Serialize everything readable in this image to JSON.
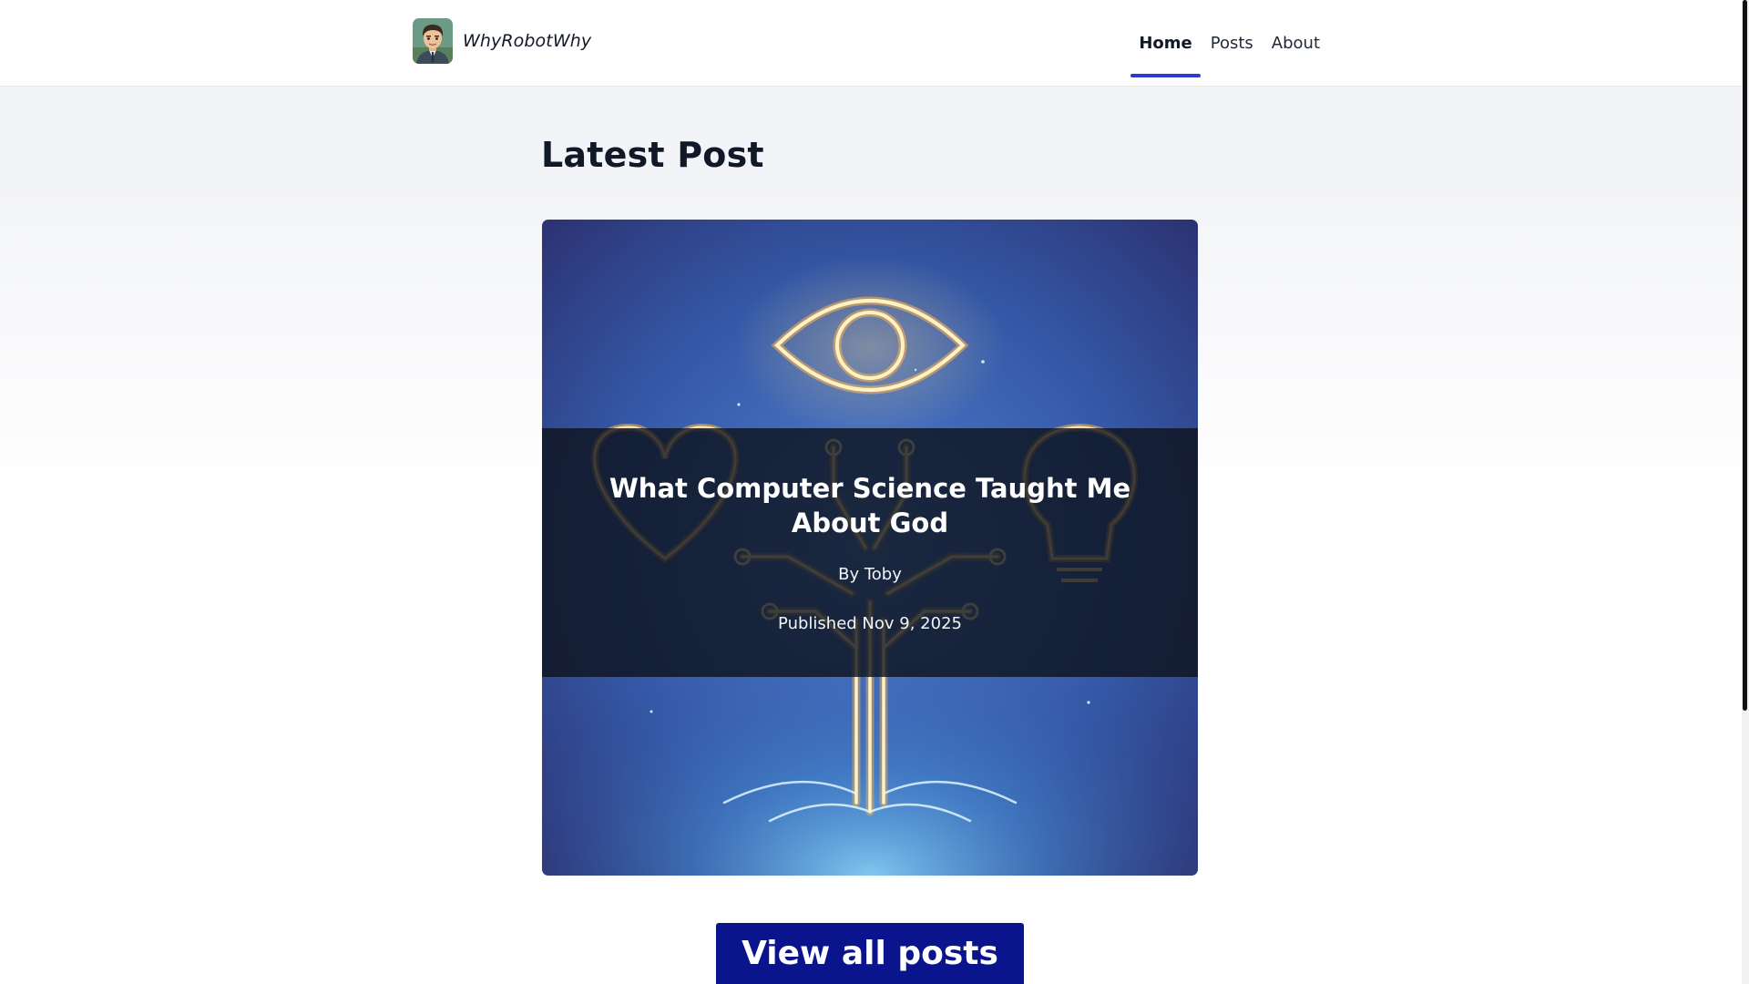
{
  "header": {
    "brand_name": "WhyRobotWhy",
    "nav": [
      {
        "label": "Home",
        "active": true
      },
      {
        "label": "Posts",
        "active": false
      },
      {
        "label": "About",
        "active": false
      }
    ],
    "accent_color": "#2b3bd6"
  },
  "main": {
    "section_title": "Latest Post",
    "latest_post": {
      "title": "What Computer Science Taught Me About God",
      "author": "By Toby",
      "published": "Published Nov 9, 2025",
      "image_icons": [
        "eye-icon",
        "heart-icon",
        "lightbulb-icon",
        "circuit-tree-icon"
      ]
    },
    "view_all_label": "View all posts",
    "button_color": "#0a148c"
  }
}
